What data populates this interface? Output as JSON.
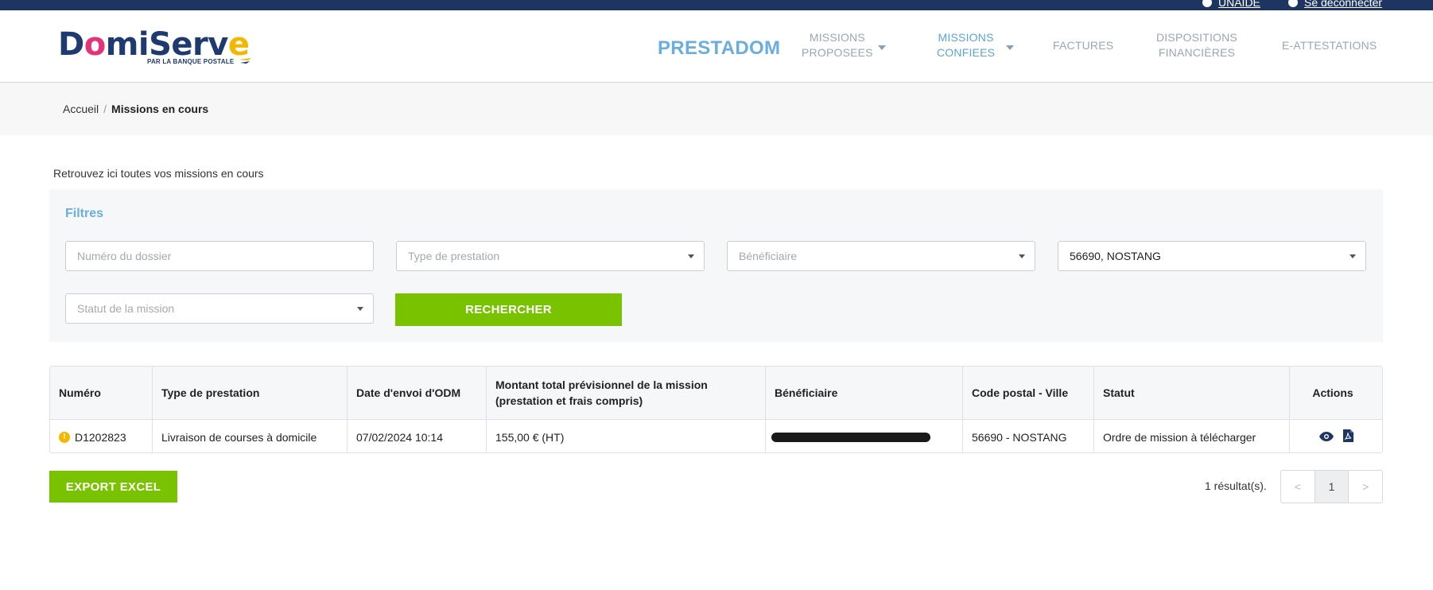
{
  "topbar": {
    "help_label": "UNAIDE",
    "logout_label": "Se déconnecter"
  },
  "logo": {
    "part1": "D",
    "o": "o",
    "part2": "miServ",
    "e": "e",
    "tagline": "PAR LA BANQUE POSTALE"
  },
  "nav": {
    "brand": "PRESTADOM",
    "items": [
      {
        "line1": "MISSIONS",
        "line2": "PROPOSEES"
      },
      {
        "line1": "MISSIONS",
        "line2": "CONFIEES"
      },
      {
        "line1": "FACTURES",
        "line2": ""
      },
      {
        "line1": "DISPOSITIONS",
        "line2": "FINANCIÈRES"
      },
      {
        "line1": "E-ATTESTATIONS",
        "line2": ""
      }
    ]
  },
  "breadcrumb": {
    "home": "Accueil",
    "separator": "/",
    "current": "Missions en cours"
  },
  "intro": "Retrouvez ici toutes vos missions en cours",
  "filters": {
    "title": "Filtres",
    "dossier_placeholder": "Numéro du dossier",
    "type_placeholder": "Type de prestation",
    "beneficiaire_placeholder": "Bénéficiaire",
    "ville_value": "56690, NOSTANG",
    "statut_placeholder": "Statut de la mission",
    "search_label": "RECHERCHER"
  },
  "table": {
    "headers": {
      "numero": "Numéro",
      "type": "Type de prestation",
      "date": "Date d'envoi d'ODM",
      "montant": "Montant total prévisionnel de la mission (prestation et frais compris)",
      "beneficiaire": "Bénéficiaire",
      "code": "Code postal - Ville",
      "statut": "Statut",
      "actions": "Actions"
    },
    "rows": [
      {
        "warning": "!",
        "numero": "D1202823",
        "type": "Livraison de courses à domicile",
        "date": "07/02/2024 10:14",
        "montant": "155,00 € (HT)",
        "code": "56690 - NOSTANG",
        "statut": "Ordre de mission à télécharger"
      }
    ]
  },
  "footer": {
    "export_label": "EXPORT EXCEL",
    "results": "1 résultat(s).",
    "pager": {
      "prev": "<",
      "page": "1",
      "next": ">"
    }
  },
  "colors": {
    "navy": "#1e3561",
    "accent_blue": "#6aaede",
    "green": "#78c200",
    "warning": "#f5b800"
  },
  "icons": [
    "user-icon",
    "power-icon",
    "warning-icon",
    "eye-icon",
    "pdf-icon",
    "caret-down-icon"
  ]
}
